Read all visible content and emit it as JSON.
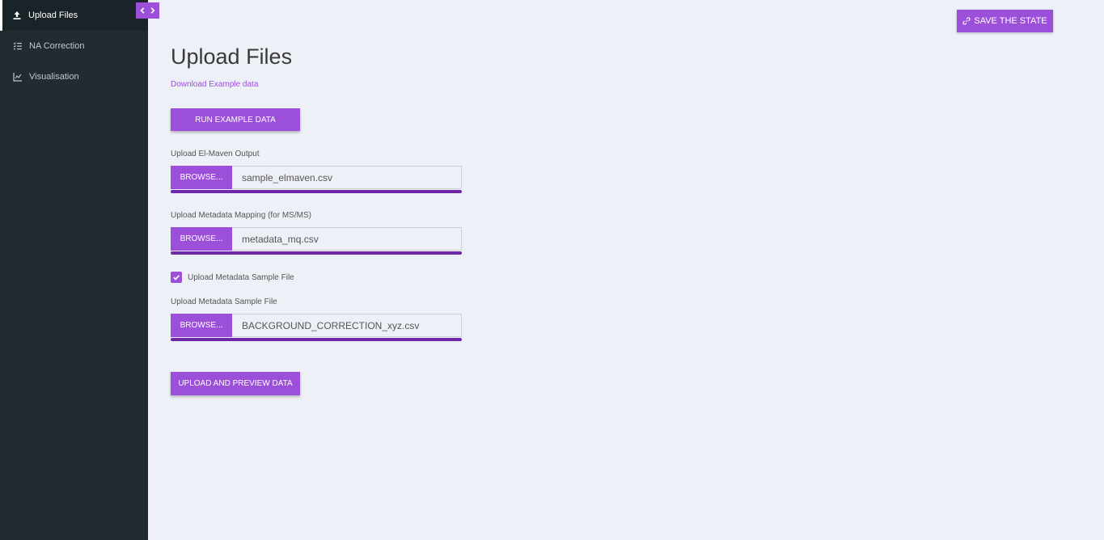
{
  "sidebar": {
    "items": [
      {
        "label": "Upload Files",
        "icon": "upload-icon",
        "active": true
      },
      {
        "label": "NA Correction",
        "icon": "list-check-icon",
        "active": false
      },
      {
        "label": "Visualisation",
        "icon": "chart-icon",
        "active": false
      }
    ]
  },
  "header": {
    "save_label": "SAVE THE STATE"
  },
  "main": {
    "title": "Upload Files",
    "download_link": "Download Example data",
    "run_example_label": "RUN EXAMPLE DATA",
    "uploads": [
      {
        "label": "Upload El-Maven Output",
        "browse": "BROWSE...",
        "filename": "sample_elmaven.csv"
      },
      {
        "label": "Upload Metadata Mapping (for MS/MS)",
        "browse": "BROWSE...",
        "filename": "metadata_mq.csv"
      },
      {
        "label": "Upload Metadata Sample File",
        "browse": "BROWSE...",
        "filename": "BACKGROUND_CORRECTION_xyz.csv"
      }
    ],
    "checkbox": {
      "label": "Upload Metadata Sample File",
      "checked": true
    },
    "upload_preview_label": "UPLOAD AND PREVIEW DATA"
  },
  "colors": {
    "accent": "#9c4fd8",
    "progress": "#6e27a8",
    "sidebar_bg": "#212b31",
    "page_bg": "#eef0f8"
  }
}
